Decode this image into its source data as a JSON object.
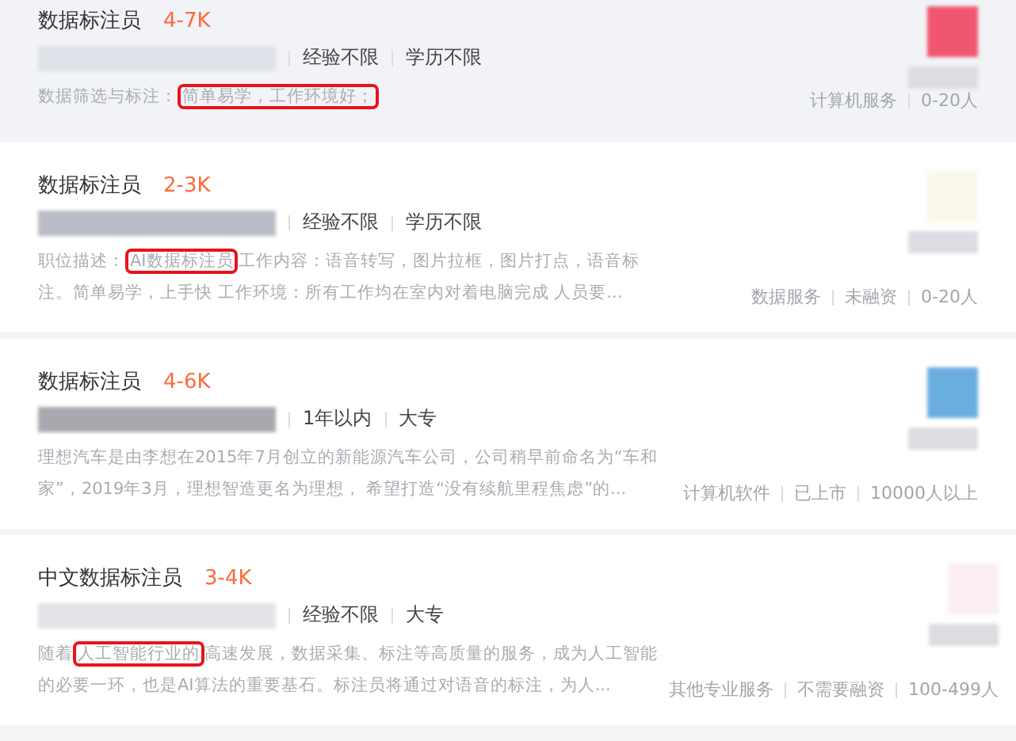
{
  "jobs": [
    {
      "title": "数据标注员",
      "salary": "4-7K",
      "highlighted": true,
      "requirements": [
        "经验不限",
        "学历不限"
      ],
      "description": {
        "before": "数据筛选与标注：",
        "highlight": "简单易学，工作环境好；"
      },
      "company_tags": [
        "计算机服务",
        "0-20人"
      ]
    },
    {
      "title": "数据标注员",
      "salary": "2-3K",
      "highlighted": false,
      "requirements": [
        "经验不限",
        "学历不限"
      ],
      "description": {
        "before": "职位描述：",
        "highlight": "AI数据标注员",
        "after": "工作内容：语音转写，图片拉框，图片打点，语音标注。简单易学，上手快 工作环境：所有工作均在室内对着电脑完成 人员要..."
      },
      "company_tags": [
        "数据服务",
        "未融资",
        "0-20人"
      ]
    },
    {
      "title": "数据标注员",
      "salary": "4-6K",
      "highlighted": false,
      "requirements": [
        "1年以内",
        "大专"
      ],
      "description": {
        "before": "理想汽车是由李想在2015年7月创立的新能源汽车公司，公司稍早前命名为“车和家”，2019年3月，理想智造更名为理想， 希望打造“没有续航里程焦虑”的..."
      },
      "company_tags": [
        "计算机软件",
        "已上市",
        "10000人以上"
      ]
    },
    {
      "title": "中文数据标注员",
      "salary": "3-4K",
      "highlighted": false,
      "requirements": [
        "经验不限",
        "大专"
      ],
      "description": {
        "before": "随着",
        "highlight": "人工智能行业的",
        "after": "高速发展，数据采集、标注等高质量的服务，成为人工智能的必要一环，也是AI算法的重要基石。标注员将通过对语音的标注，为人..."
      },
      "company_tags": [
        "其他专业服务",
        "不需要融资",
        "100-499人"
      ]
    }
  ]
}
